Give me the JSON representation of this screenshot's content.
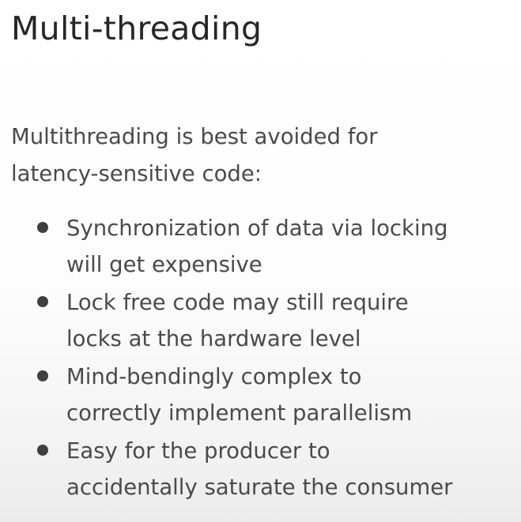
{
  "slide": {
    "title": "Multi-threading",
    "intro": {
      "line1": "Multithreading is best avoided for",
      "line2": "latency-sensitive code:"
    },
    "bullets": [
      {
        "line1": "Synchronization of data via locking",
        "line2": "will get expensive"
      },
      {
        "line1": "Lock free code may still require",
        "line2": "locks at the hardware level"
      },
      {
        "line1": "Mind-bendingly complex to",
        "line2": "correctly implement parallelism"
      },
      {
        "line1": "Easy for the producer to",
        "line2": "accidentally saturate the consumer"
      }
    ]
  },
  "colors": {
    "text": "#4a4a4a",
    "title": "#262626",
    "bullet_dot": "#3f3f3f",
    "background": "#ffffff"
  }
}
